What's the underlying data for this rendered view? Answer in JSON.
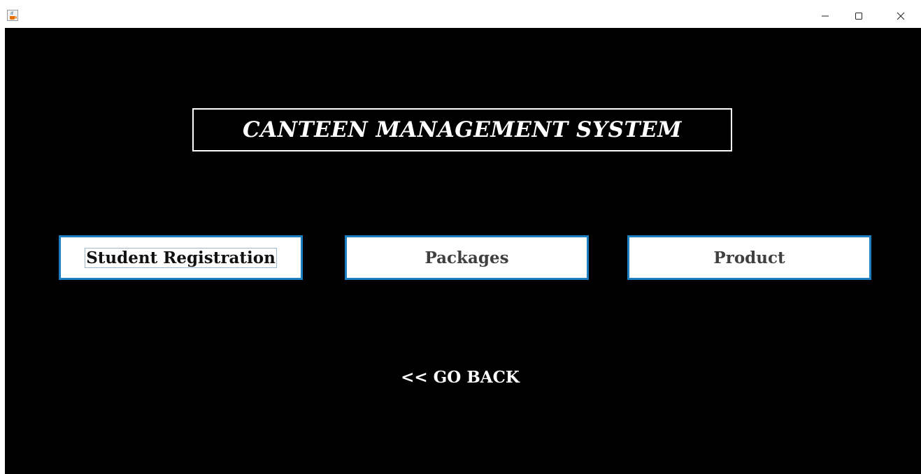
{
  "window": {
    "app_icon": "java-coffee-cup-icon",
    "controls": {
      "minimize": "minimize-icon",
      "maximize": "maximize-icon",
      "close": "close-icon"
    }
  },
  "main": {
    "title": "CANTEEN MANAGEMENT SYSTEM",
    "buttons": [
      {
        "label": "Student Registration"
      },
      {
        "label": "Packages"
      },
      {
        "label": "Product"
      }
    ],
    "go_back_label": "<< GO BACK"
  },
  "colors": {
    "background": "#000000",
    "button_border": "#1e7fc0",
    "title_border": "#ffffff"
  }
}
